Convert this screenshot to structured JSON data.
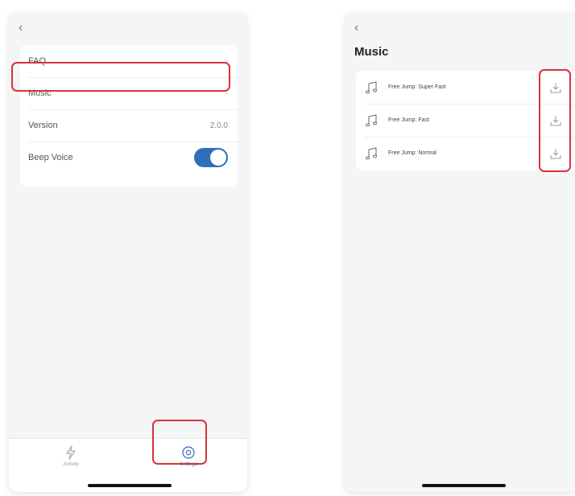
{
  "settings_screen": {
    "rows": [
      {
        "label": "FAQ",
        "chevron": "›"
      },
      {
        "label": "Music",
        "chevron": "›"
      },
      {
        "label": "Version",
        "value": "2.0.0"
      },
      {
        "label": "Beep Voice",
        "toggle_on": true
      }
    ],
    "tabs": [
      {
        "label": "Activity",
        "icon": "lightning-icon"
      },
      {
        "label": "Settings",
        "icon": "gear-icon",
        "active": true
      }
    ]
  },
  "music_screen": {
    "title": "Music",
    "tracks": [
      {
        "name": "Free Jump: Super Fast",
        "icon": "music-note-icon",
        "action_icon": "download-icon"
      },
      {
        "name": "Free Jump: Fast",
        "icon": "music-note-icon",
        "action_icon": "download-icon"
      },
      {
        "name": "Free Jump: Normal",
        "icon": "music-note-icon",
        "action_icon": "download-icon"
      }
    ]
  },
  "colors": {
    "accent": "#2f6fb8",
    "highlight": "#d9323a",
    "screen_bg": "#f4f5f7"
  },
  "back_glyph": "‹"
}
